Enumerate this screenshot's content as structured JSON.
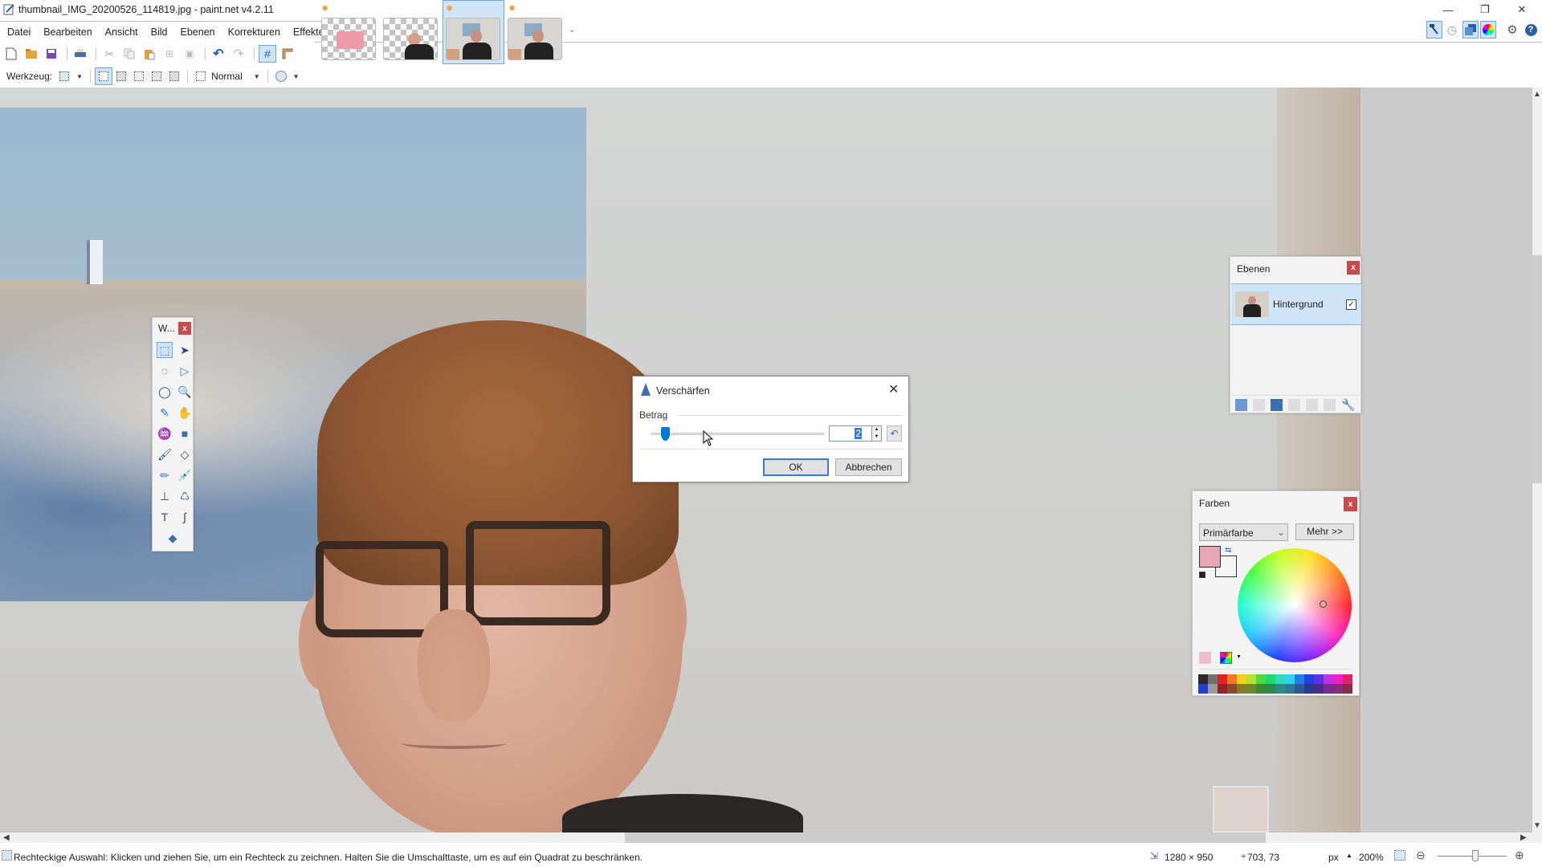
{
  "window": {
    "title": "thumbnail_IMG_20200526_114819.jpg - paint.net v4.2.11",
    "minimize_label": "—",
    "restore_label": "❐",
    "close_label": "✕"
  },
  "menu": {
    "items": [
      "Datei",
      "Bearbeiten",
      "Ansicht",
      "Bild",
      "Ebenen",
      "Korrekturen",
      "Effekte"
    ]
  },
  "image_tabs": [
    {
      "name": "pink-rectangle-image",
      "dirty": true,
      "selected": false
    },
    {
      "name": "person-transparent-image",
      "dirty": false,
      "selected": false
    },
    {
      "name": "thumbnail-photo",
      "dirty": true,
      "selected": true
    },
    {
      "name": "photo-copy",
      "dirty": true,
      "selected": false
    }
  ],
  "toolbar": {
    "icons": [
      "new-file-icon",
      "open-file-icon",
      "save-icon",
      "print-icon",
      "cut-icon",
      "copy-icon",
      "paste-icon",
      "crop-icon",
      "deselect-icon",
      "undo-icon",
      "redo-icon",
      "grid-icon",
      "ruler-icon"
    ]
  },
  "tool_options": {
    "tool_label": "Werkzeug:",
    "blend_mode": "Normal"
  },
  "right_toolbar": {
    "icons": [
      "tools-window-icon",
      "history-window-icon",
      "layers-window-icon",
      "colors-window-icon",
      "settings-icon",
      "help-icon"
    ]
  },
  "tools_window": {
    "title": "W...",
    "close_label": "x",
    "tools": [
      {
        "name": "rectangle-select-tool",
        "glyph": "⬚",
        "active": true
      },
      {
        "name": "move-selected-pixels-tool",
        "glyph": "➤"
      },
      {
        "name": "lasso-select-tool",
        "glyph": "◌"
      },
      {
        "name": "move-selection-tool",
        "glyph": "▷"
      },
      {
        "name": "ellipse-select-tool",
        "glyph": "◯"
      },
      {
        "name": "zoom-tool",
        "glyph": "🔍"
      },
      {
        "name": "magic-wand-tool",
        "glyph": "✎"
      },
      {
        "name": "pan-tool",
        "glyph": "✋"
      },
      {
        "name": "paint-bucket-tool",
        "glyph": "♒"
      },
      {
        "name": "gradient-tool",
        "glyph": "■"
      },
      {
        "name": "paintbrush-tool",
        "glyph": "🖌"
      },
      {
        "name": "eraser-tool",
        "glyph": "◇"
      },
      {
        "name": "pencil-tool",
        "glyph": "✏"
      },
      {
        "name": "color-picker-tool",
        "glyph": "💉"
      },
      {
        "name": "clone-stamp-tool",
        "glyph": "⊥"
      },
      {
        "name": "recolor-tool",
        "glyph": "♺"
      },
      {
        "name": "text-tool",
        "glyph": "T"
      },
      {
        "name": "line-curve-tool",
        "glyph": "∫"
      },
      {
        "name": "shapes-tool",
        "glyph": "◆"
      }
    ]
  },
  "layers_window": {
    "title": "Ebenen",
    "close_label": "x",
    "layers": [
      {
        "name": "Hintergrund",
        "visible": true,
        "check": "✓"
      }
    ],
    "buttons": [
      "add-layer-icon",
      "delete-layer-icon",
      "duplicate-layer-icon",
      "merge-layer-icon",
      "move-layer-up-icon",
      "move-layer-down-icon",
      "layer-properties-icon"
    ]
  },
  "colors_window": {
    "title": "Farben",
    "close_label": "x",
    "mode_select": "Primärfarbe",
    "more_button": "Mehr >>",
    "primary_color": "#e8a6b4",
    "secondary_color": "#f5f5f5",
    "palette_top": [
      "#2a2a2a",
      "#6e6e6e",
      "#e02424",
      "#f07a20",
      "#f0d020",
      "#b8e030",
      "#50d840",
      "#20d870",
      "#30d8c0",
      "#30d0f0",
      "#2080e0",
      "#2040e0",
      "#6030e0",
      "#c030e0",
      "#f020c0",
      "#e0206a"
    ],
    "palette_bottom": [
      "#2040d0",
      "#9a9a9a",
      "#9a2028",
      "#8a4a2a",
      "#8a7a28",
      "#6a8a28",
      "#3a8a30",
      "#2a8a48",
      "#2a8a80",
      "#2a7a9a",
      "#2a5a9a",
      "#2a3a8a",
      "#4a2a8a",
      "#7a2a8a",
      "#8a2a7a",
      "#8a2a4a"
    ]
  },
  "dialog": {
    "title": "Verschärfen",
    "close_label": "✕",
    "amount_label": "Betrag",
    "amount_value": "2",
    "amount_min": 1,
    "amount_max": 20,
    "ok_label": "OK",
    "cancel_label": "Abbrechen",
    "reset_label": "↶"
  },
  "statusbar": {
    "hint": "Rechteckige Auswahl: Klicken und ziehen Sie, um ein Rechteck zu zeichnen. Halten Sie die Umschalttaste, um es auf ein Quadrat zu beschränken.",
    "image_size": "1280 × 950",
    "cursor_position": "703, 73",
    "units": "px",
    "zoom": "200%",
    "zoom_slider_fraction": 0.55
  },
  "accent_color": "#0078d7"
}
